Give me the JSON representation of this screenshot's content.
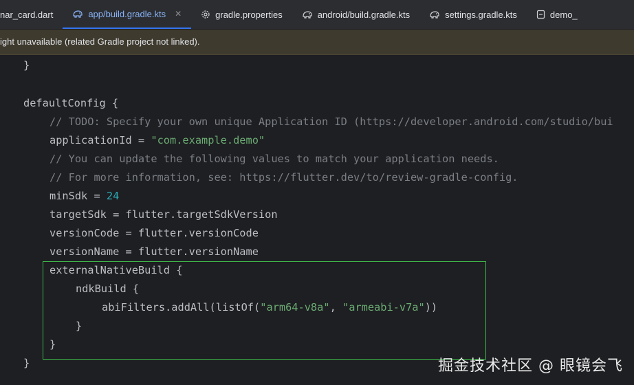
{
  "tabs": [
    {
      "label": "nar_card.dart",
      "icon": "dart-file-icon"
    },
    {
      "label": "app/build.gradle.kts",
      "icon": "gradle-elephant-icon",
      "active": true
    },
    {
      "label": "gradle.properties",
      "icon": "gear-icon"
    },
    {
      "label": "android/build.gradle.kts",
      "icon": "gradle-elephant-icon"
    },
    {
      "label": "settings.gradle.kts",
      "icon": "gradle-elephant-icon"
    },
    {
      "label": "demo_",
      "icon": "file-icon"
    }
  ],
  "banner": {
    "text": "ight unavailable (related Gradle project not linked)."
  },
  "code": {
    "l1": "}",
    "l2": "defaultConfig {",
    "l3": "// TODO: Specify your own unique Application ID (https://developer.android.com/studio/bui",
    "l4a": "applicationId = ",
    "l4b": "\"com.example.demo\"",
    "l5": "// You can update the following values to match your application needs.",
    "l6": "// For more information, see: https://flutter.dev/to/review-gradle-config.",
    "l7a": "minSdk = ",
    "l7b": "24",
    "l8": "targetSdk = flutter.targetSdkVersion",
    "l9": "versionCode = flutter.versionCode",
    "l10": "versionName = flutter.versionName",
    "l11": "externalNativeBuild {",
    "l12": "ndkBuild {",
    "l13a": "abiFilters.addAll(listOf(",
    "l13b": "\"arm64-v8a\"",
    "l13c": ", ",
    "l13d": "\"armeabi-v7a\"",
    "l13e": "))",
    "l14": "}",
    "l15": "}",
    "l16": "}"
  },
  "watermark": "掘金技术社区 @ 眼镜会飞",
  "colors": {
    "highlight_box": "#3dbb4a",
    "active_tab": "#3574f0"
  }
}
